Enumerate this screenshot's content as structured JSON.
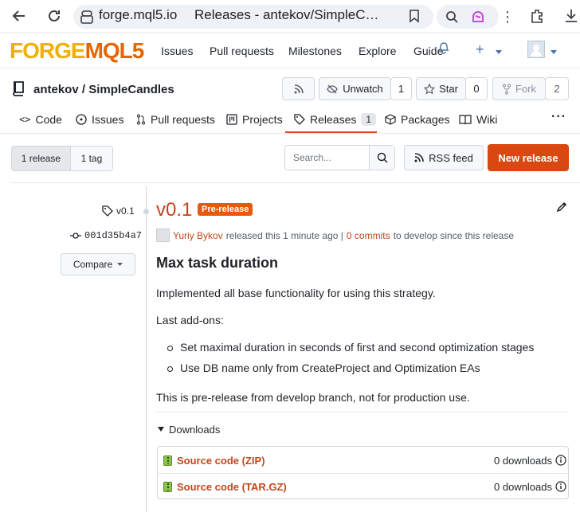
{
  "browser": {
    "url": "forge.mql5.io",
    "tab_title": "Releases - antekov/SimpleCandles"
  },
  "site": {
    "logo_part1": "FORGE",
    "logo_part2": "MQL5",
    "nav": [
      "Issues",
      "Pull requests",
      "Milestones",
      "Explore",
      "Guide"
    ]
  },
  "repo": {
    "owner_repo": "antekov / SimpleCandles",
    "unwatch_label": "Unwatch",
    "watch_count": "1",
    "star_label": "Star",
    "star_count": "0",
    "fork_label": "Fork",
    "fork_count": "2"
  },
  "tabs": {
    "code": "Code",
    "issues": "Issues",
    "pull_requests": "Pull requests",
    "projects": "Projects",
    "releases": "Releases",
    "releases_count": "1",
    "packages": "Packages",
    "wiki": "Wiki"
  },
  "toolbar": {
    "releases_seg": "1 release",
    "tags_seg": "1 tag",
    "search_placeholder": "Search...",
    "rss_label": "RSS feed",
    "new_release_label": "New release"
  },
  "release": {
    "tag": "v0.1",
    "commit": "001d35b4a7",
    "compare_label": "Compare",
    "title": "v0.1",
    "badge": "Pre-release",
    "author": "Yuriy Bykov",
    "meta_mid": "released this 1 minute ago |",
    "commits_link": "0 commits",
    "meta_end": "to develop since this release",
    "heading": "Max task duration",
    "p1": "Implemented all base functionality for using this strategy.",
    "p2": "Last add-ons:",
    "bullets": [
      "Set maximal duration in seconds of first and second optimization stages",
      "Use DB name only from CreateProject and Optimization EAs"
    ],
    "p3": "This is pre-release from develop branch, not for production use.",
    "downloads_label": "Downloads",
    "assets": [
      {
        "name": "Source code (ZIP)",
        "count": "0 downloads"
      },
      {
        "name": "Source code (TAR.GZ)",
        "count": "0 downloads"
      }
    ]
  }
}
